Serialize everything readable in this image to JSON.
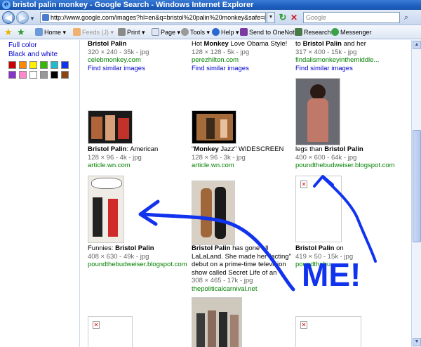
{
  "window": {
    "title": "bristol palin monkey - Google Search - Windows Internet Explorer"
  },
  "navigation": {
    "address": "http://www.google.com/images?hl=en&q=bristol%20palin%20monkey&safe=images&um=",
    "search_placeholder": "Google"
  },
  "commandbar": {
    "home": "Home",
    "feeds": "Feeds (J)",
    "print": "Print",
    "page": "Page",
    "tools": "Tools",
    "help": "Help",
    "onenote": "Send to OneNote",
    "research": "Research",
    "messenger": "Messenger"
  },
  "sidebar": {
    "full_color": "Full color",
    "black_white": "Black and white",
    "swatches": [
      "#cc0000",
      "#ff8800",
      "#ffee00",
      "#33bb00",
      "#22bbcc",
      "#1133ee",
      "#8833cc",
      "#ff88cc",
      "#ffffff",
      "#999999",
      "#000000",
      "#8b4513"
    ]
  },
  "results": {
    "row1": [
      {
        "title_bold": "Bristol Palin",
        "meta": "320 × 240 - 35k - jpg",
        "url": "celebmonkey.com",
        "similar": "Find similar images"
      },
      {
        "title_pre": "Hot ",
        "title_bold": "Monkey",
        "title_post": " Love Obama Style!",
        "meta": "128 × 128 - 5k - jpg",
        "url": "perezhilton.com",
        "similar": "Find similar images"
      },
      {
        "title_pre": "to ",
        "title_bold": "Bristol Palin",
        "title_post": " and her",
        "meta": "317 × 400 - 15k - jpg",
        "url": "findalismonkeyinthemiddle...",
        "similar": "Find similar images"
      }
    ],
    "row2": [
      {
        "title_bold": "Bristol Palin",
        "title_post": ": American",
        "meta": "128 × 96 - 4k - jpg",
        "url": "article.wn.com"
      },
      {
        "title_pre": "\"",
        "title_bold": "Monkey",
        "title_post": " Jazz\" WIDESCREEN",
        "meta": "128 × 96 - 3k - jpg",
        "url": "article.wn.com"
      },
      {
        "title_pre": "legs than ",
        "title_bold": "Bristol Palin",
        "meta": "400 × 600 - 64k - jpg",
        "url": "poundthebudweiser.blogspot.com"
      }
    ],
    "row3": [
      {
        "title_pre": "Funnies: ",
        "title_bold": "Bristol Palin",
        "meta": "408 × 630 - 49k - jpg",
        "url": "poundthebudweiser.blogspot.com"
      },
      {
        "title_bold": "Bristol Palin",
        "title_post": " has gone all LaLaLand. She made her \"acting\" debut on a prime-time television show called Secret Life of an",
        "meta": "308 × 465 - 17k - jpg",
        "url": "thepoliticalcarnival.net"
      },
      {
        "title_bold": "Bristol Palin",
        "title_post": " on",
        "meta": "419 × 50 - 15k - jpg",
        "url": "poundthebu..."
      }
    ]
  },
  "annotation": {
    "text": "ME!"
  },
  "colors": {
    "link": "#0000cc",
    "url": "#008000",
    "scribble": "#1133ee"
  }
}
